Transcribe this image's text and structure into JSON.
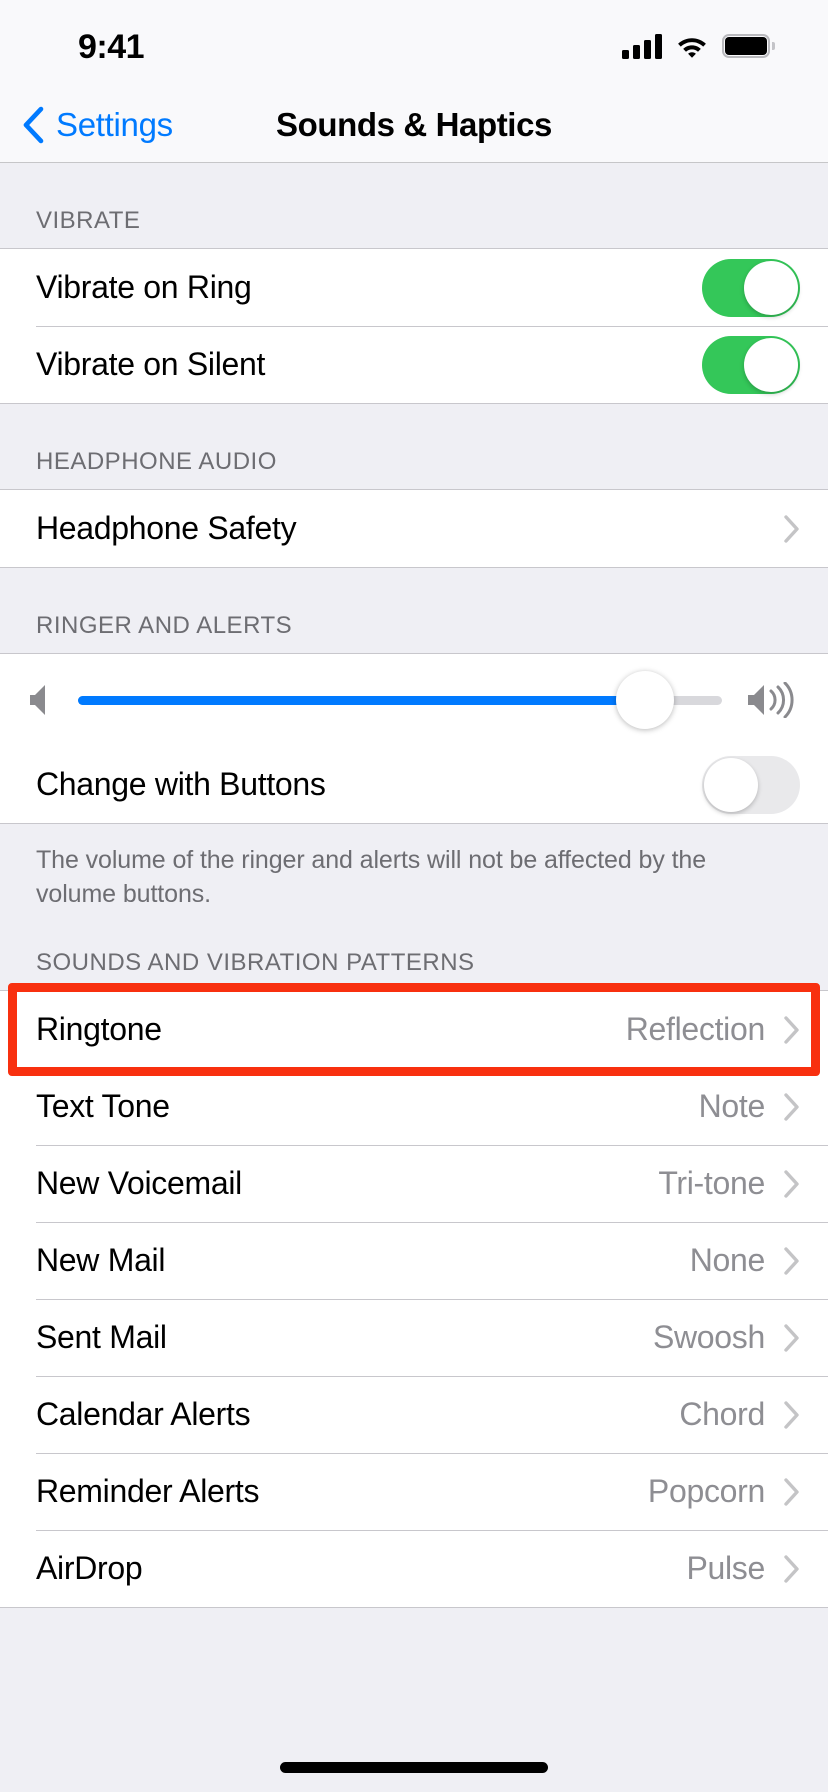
{
  "status_bar": {
    "time": "9:41",
    "cellular_icon": "cellular-signal-icon",
    "cellular_bars": 4,
    "wifi_icon": "wifi-icon",
    "battery_icon": "battery-full-icon"
  },
  "nav": {
    "back_label": "Settings",
    "back_icon": "chevron-left-icon",
    "title": "Sounds & Haptics"
  },
  "sections": [
    {
      "header": "VIBRATE",
      "rows": [
        {
          "label": "Vibrate on Ring",
          "control": "toggle",
          "value": "on"
        },
        {
          "label": "Vibrate on Silent",
          "control": "toggle",
          "value": "on"
        }
      ]
    },
    {
      "header": "HEADPHONE AUDIO",
      "rows": [
        {
          "label": "Headphone Safety",
          "control": "disclosure",
          "value": ""
        }
      ]
    },
    {
      "header": "RINGER AND ALERTS",
      "rows": [
        {
          "label": "Change with Buttons",
          "control": "toggle",
          "value": "off"
        }
      ],
      "slider": {
        "min_icon": "speaker-low-icon",
        "max_icon": "speaker-high-icon",
        "value_percent": 88
      },
      "footnote": "The volume of the ringer and alerts will not be affected by the volume buttons."
    },
    {
      "header": "SOUNDS AND VIBRATION PATTERNS",
      "rows": [
        {
          "label": "Ringtone",
          "value": "Reflection",
          "control": "disclosure",
          "highlighted": true
        },
        {
          "label": "Text Tone",
          "value": "Note",
          "control": "disclosure"
        },
        {
          "label": "New Voicemail",
          "value": "Tri-tone",
          "control": "disclosure"
        },
        {
          "label": "New Mail",
          "value": "None",
          "control": "disclosure"
        },
        {
          "label": "Sent Mail",
          "value": "Swoosh",
          "control": "disclosure"
        },
        {
          "label": "Calendar Alerts",
          "value": "Chord",
          "control": "disclosure"
        },
        {
          "label": "Reminder Alerts",
          "value": "Popcorn",
          "control": "disclosure"
        },
        {
          "label": "AirDrop",
          "value": "Pulse",
          "control": "disclosure"
        }
      ]
    }
  ],
  "colors": {
    "accent_blue": "#007aff",
    "toggle_on_green": "#34c759",
    "highlight_red": "#f8300f",
    "group_background": "#efeff4",
    "secondary_text": "#8e8e93"
  }
}
